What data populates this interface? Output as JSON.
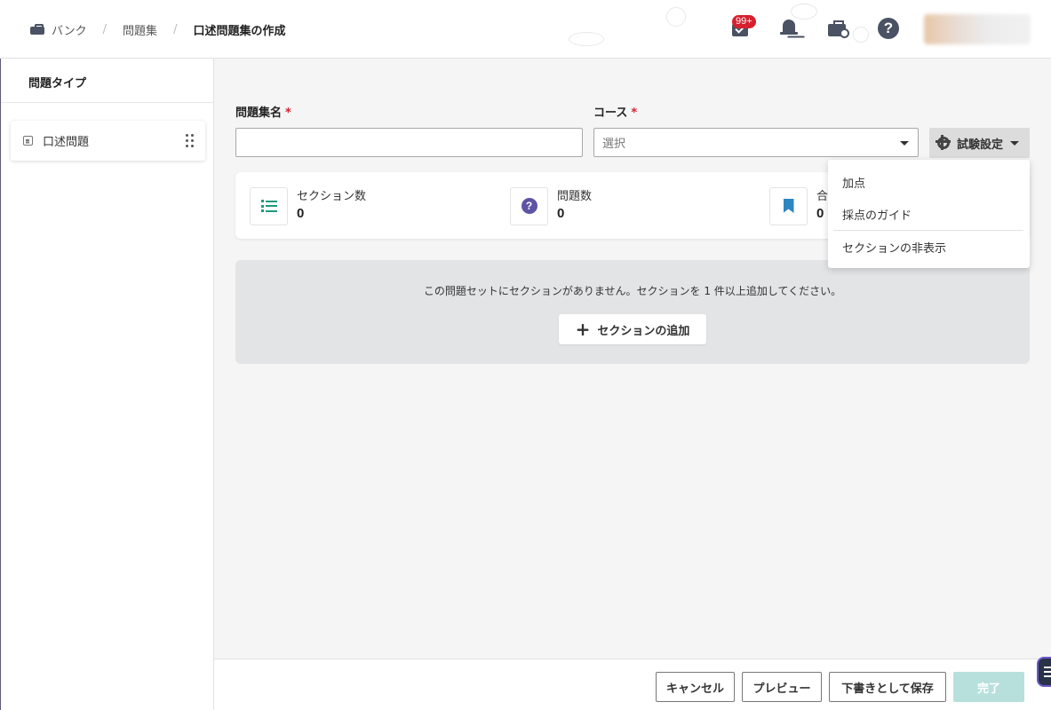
{
  "breadcrumb": {
    "bank": "バンク",
    "question_sets": "問題集",
    "current": "口述問題集の作成"
  },
  "header": {
    "badge_count": "99+",
    "help_glyph": "?"
  },
  "sidebar": {
    "title": "問題タイプ",
    "items": [
      {
        "label": "口述問題"
      }
    ]
  },
  "form": {
    "name_label": "問題集名",
    "name_value": "",
    "required_mark": "*",
    "course_label": "コース",
    "course_placeholder": "選択",
    "settings_label": "試験設定"
  },
  "stats": [
    {
      "label": "セクション数",
      "value": "0",
      "icon": "list-icon"
    },
    {
      "label": "問題数",
      "value": "0",
      "icon": "question-icon"
    },
    {
      "label": "合",
      "value": "0",
      "icon": "bookmark-icon"
    }
  ],
  "sections": {
    "empty_message": "この問題セットにセクションがありません。セクションを 1 件以上追加してください。",
    "add_label": "セクションの追加"
  },
  "settings_menu": {
    "items": [
      "加点",
      "採点のガイド",
      "セクションの非表示"
    ]
  },
  "footer": {
    "cancel": "キャンセル",
    "preview": "プレビュー",
    "save_draft": "下書きとして保存",
    "done": "完了"
  },
  "colors": {
    "accent_green": "#1c9b7c",
    "question_purple": "#5d54a4",
    "bookmark_blue": "#2e86c1",
    "badge_red": "#d6202e",
    "done_disabled": "#b7e0dc"
  }
}
